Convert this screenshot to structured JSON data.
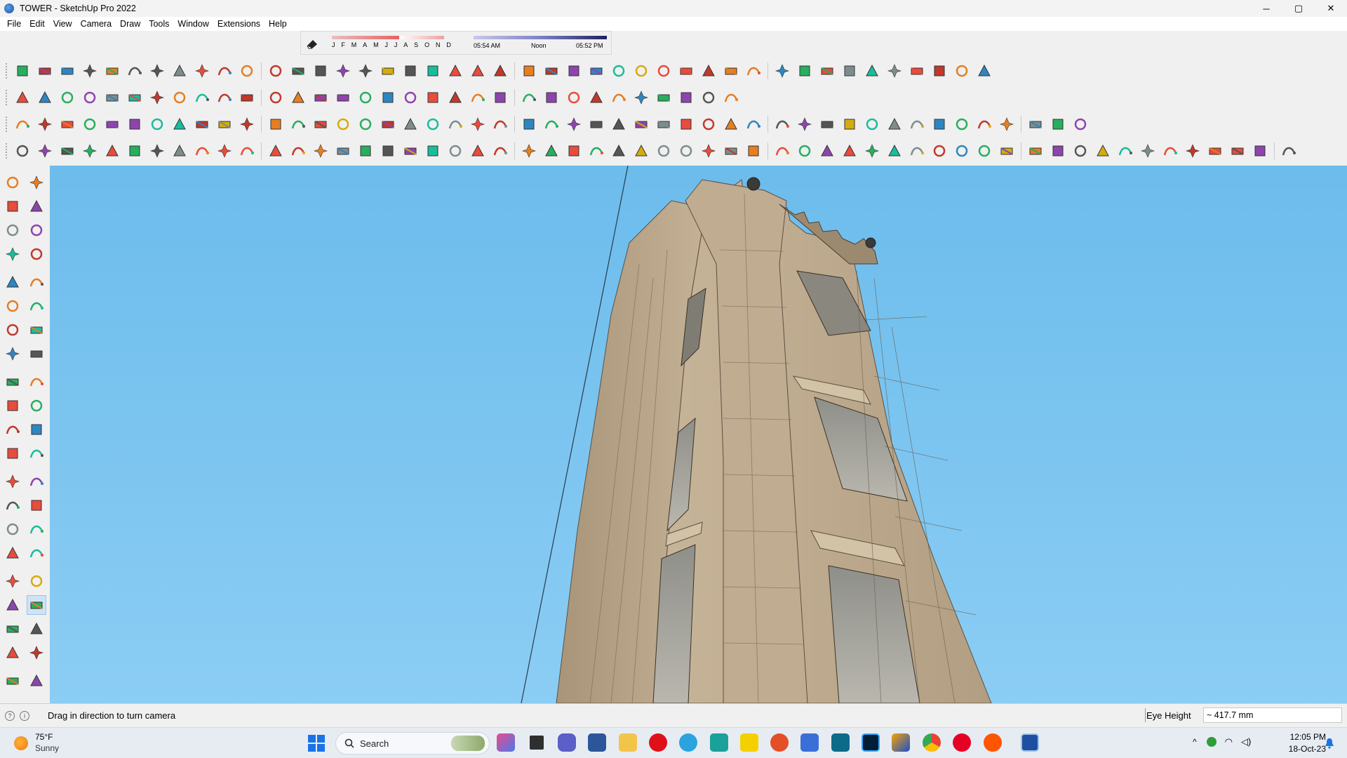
{
  "window": {
    "title": "TOWER - SketchUp Pro 2022",
    "controls": [
      "─",
      "▢",
      "✕"
    ]
  },
  "menu": [
    "File",
    "Edit",
    "View",
    "Camera",
    "Draw",
    "Tools",
    "Window",
    "Extensions",
    "Help"
  ],
  "shadows": {
    "months": [
      "J",
      "F",
      "M",
      "A",
      "M",
      "J",
      "J",
      "A",
      "S",
      "O",
      "N",
      "D"
    ],
    "sunrise": "05:54 AM",
    "noon": "Noon",
    "sunset": "05:52 PM"
  },
  "status": {
    "message": "Drag in direction to turn camera",
    "measurement_label": "Eye Height",
    "measurement_value": "~ 417.7 mm"
  },
  "taskbar": {
    "temperature": "75°F",
    "condition": "Sunny",
    "search_label": "Search",
    "time": "12:05 PM",
    "date": "18-Oct-23"
  },
  "toolbar_icons": {
    "row1": [
      "freehand-icon",
      "polyline-icon",
      "curve-icon",
      "scissor-icon",
      "gear-icon",
      "paint-icon",
      "path-icon",
      "sphere-icon",
      "bezier-icon",
      "fillet-icon",
      "corner-icon",
      "trim-icon",
      "extend-icon",
      "extrude-icon",
      "taper-icon",
      "array-icon",
      "stair-icon",
      "gem-icon",
      "loft-icon",
      "sweep-icon",
      "roof-icon",
      "wall-icon",
      "beam-icon",
      "rail-icon",
      "fence-icon",
      "pipe-icon",
      "window-icon",
      "door-icon",
      "column-icon",
      "frame-icon",
      "truss-icon",
      "panel-icon",
      "mesh-icon",
      "grid-icon",
      "bars-icon",
      "fan-icon",
      "lattice-icon",
      "shape-icon",
      "house-icon",
      "house-icon",
      "house-icon",
      "house-icon",
      "house-icon"
    ],
    "row2": [
      "zoom-icon",
      "select-icon",
      "eraser-icon",
      "pencil-icon",
      "arc-icon",
      "rectangle-icon",
      "push-pull-icon",
      "follow-me-icon",
      "move-icon",
      "rotate-icon",
      "scale-icon",
      "tape-icon",
      "text-icon",
      "paint-bucket-icon",
      "orbit-icon",
      "pan-icon",
      "zoom-window-icon",
      "zoom-extents-icon",
      "layers-icon",
      "scenes-icon",
      "styles-icon",
      "outliner-icon",
      "entity-icon",
      "shadow-icon",
      "arrow-down-icon",
      "arrow-down-icon",
      "arrow-down-icon",
      "arrow-down-icon",
      "arrow-down-icon",
      "arrow-down-icon",
      "arrow-down-icon",
      "brush-icon"
    ],
    "row3": [
      "camera-icon",
      "cube-icon",
      "cube-icon",
      "plant-icon",
      "slash-icon",
      "grid-icon",
      "square-icon",
      "group-icon",
      "component-icon",
      "note-icon",
      "ruler-icon",
      "shape-icon",
      "circle-icon",
      "polygon-icon",
      "ellipse-icon",
      "parallelogram-icon",
      "arc-icon",
      "circle-icon",
      "star-icon",
      "blob-icon",
      "blob-icon",
      "line-icon",
      "brush-icon",
      "plane-icon",
      "plane-icon",
      "plane-icon",
      "leaf-icon",
      "tree-icon",
      "globe-icon",
      "globe-icon",
      "shell-icon",
      "shell-icon",
      "shell-icon",
      "refresh-icon",
      "level-icon",
      "level-icon",
      "frame-icon",
      "frame-icon",
      "frame-icon",
      "lock-icon",
      "terrain-icon",
      "terrain-icon",
      "cut-icon",
      "cut-icon",
      "cut-icon",
      "cut-icon",
      "cut-icon"
    ],
    "row4": [
      "select-box-icon",
      "umbrella-icon",
      "circle-icon",
      "angle-icon",
      "protractor-icon",
      "sun-icon",
      "dome-icon",
      "sphere-icon",
      "shadow-icon",
      "solid-icon",
      "wire-icon",
      "iso-icon",
      "iso-icon",
      "iso-icon",
      "iso-icon",
      "iso-icon",
      "hand-icon",
      "face-icon",
      "face-icon",
      "face-icon",
      "face-icon",
      "face-icon",
      "face-icon",
      "curve-icon",
      "red-square-icon",
      "box-icon",
      "flag-icon",
      "wood-icon",
      "chain-icon",
      "hook-icon",
      "dots-icon",
      "plus-icon",
      "plus-icon",
      "x-icon",
      "cone-icon",
      "cone-icon",
      "triangle-icon",
      "u-icon",
      "ring-icon",
      "ring-icon",
      "cross-icon",
      "bucket-icon",
      "magnet-icon",
      "puzzle-icon",
      "cube-icon",
      "cube-icon",
      "cube-icon",
      "cube-icon",
      "cube-icon",
      "cube-icon",
      "grid-icon",
      "grid-icon",
      "grid-icon",
      "x-small-icon",
      "lasso-icon",
      "tiles-icon"
    ]
  },
  "left_toolbar_icons": [
    "select-icon",
    "orbit-icon",
    "paint-bucket-icon",
    "eraser-icon",
    "component-icon",
    "tape-icon",
    "pencil-icon",
    "freehand-icon",
    "rectangle-icon",
    "rotated-rectangle-icon",
    "circle-icon",
    "polygon-icon",
    "arc-icon",
    "pie-icon",
    "two-point-arc-icon",
    "three-point-arc-icon",
    "move-icon",
    "push-pull-icon",
    "rotate-icon",
    "follow-me-icon",
    "scale-icon",
    "offset-icon",
    "tape-measure-icon",
    "dimension-icon",
    "protractor-icon",
    "text-icon",
    "axes-icon",
    "3d-text-icon",
    "orbit-icon",
    "pan-icon",
    "zoom-icon",
    "zoom-window-icon",
    "zoom-extents-icon",
    "previous-icon",
    "position-camera-icon",
    "look-around-icon",
    "walk-icon",
    "section-plane-icon",
    "layers-icon",
    "scenes-icon",
    "styles-icon",
    "outliner-icon"
  ],
  "colors": {
    "sky_top": "#6cbcec",
    "sky_bottom": "#8bcdf4",
    "stone": "#b8a48a",
    "stone_dark": "#8c7a62",
    "accent": "#1f6fd0"
  }
}
